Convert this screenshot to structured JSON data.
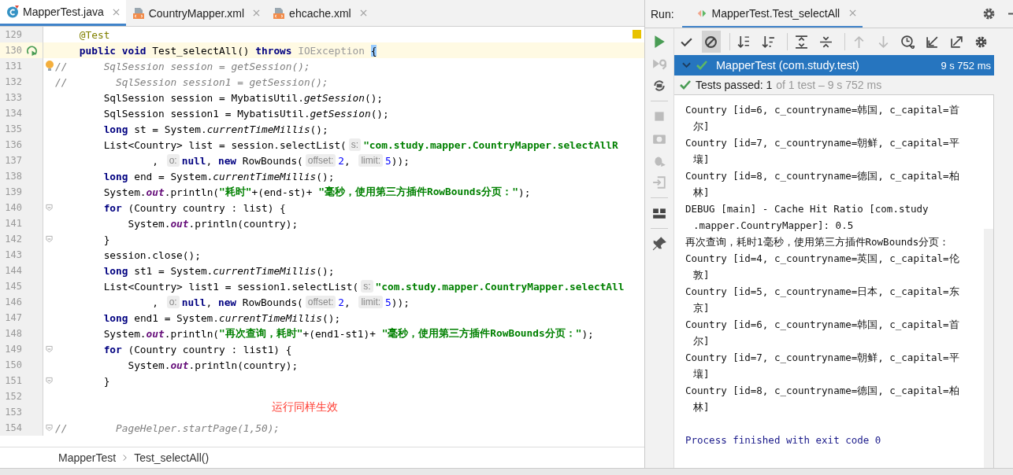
{
  "editor_tabs": [
    {
      "label": "MapperTest.java",
      "kind": "java",
      "selected": true
    },
    {
      "label": "CountryMapper.xml",
      "kind": "xml",
      "selected": false
    },
    {
      "label": "ehcache.xml",
      "kind": "xml",
      "selected": false
    }
  ],
  "code_lines": [
    {
      "number": "129",
      "current": false,
      "kind": "plain",
      "tokens": [
        {
          "kind": "ann",
          "text": "    @Test"
        }
      ]
    },
    {
      "number": "130",
      "current": true,
      "kind": "run",
      "tokens": [
        {
          "kind": "kw",
          "text": "    public void "
        },
        {
          "kind": "txt",
          "text": "Test_selectAll() "
        },
        {
          "kind": "kw",
          "text": "throws "
        },
        {
          "kind": "type",
          "text": "IOException "
        },
        {
          "kind": "brace",
          "text": "{"
        }
      ]
    },
    {
      "number": "131",
      "current": false,
      "kind": "bulb",
      "tokens": [
        {
          "kind": "cmt",
          "text": "//      SqlSession session = getSession();"
        }
      ]
    },
    {
      "number": "132",
      "current": false,
      "kind": "plain",
      "tokens": [
        {
          "kind": "cmt",
          "text": "//        SqlSession session1 = getSession();"
        }
      ]
    },
    {
      "number": "133",
      "current": false,
      "kind": "plain",
      "tokens": [
        {
          "kind": "txt",
          "text": "        SqlSession session = MybatisUtil."
        },
        {
          "kind": "ital",
          "text": "getSession"
        },
        {
          "kind": "txt",
          "text": "();"
        }
      ]
    },
    {
      "number": "134",
      "current": false,
      "kind": "plain",
      "tokens": [
        {
          "kind": "txt",
          "text": "        SqlSession session1 = MybatisUtil."
        },
        {
          "kind": "ital",
          "text": "getSession"
        },
        {
          "kind": "txt",
          "text": "();"
        }
      ]
    },
    {
      "number": "135",
      "current": false,
      "kind": "plain",
      "tokens": [
        {
          "kind": "kw",
          "text": "        long "
        },
        {
          "kind": "txt",
          "text": "st = System."
        },
        {
          "kind": "ital",
          "text": "currentTimeMillis"
        },
        {
          "kind": "txt",
          "text": "();"
        }
      ]
    },
    {
      "number": "136",
      "current": false,
      "kind": "plain",
      "tokens": [
        {
          "kind": "txt",
          "text": "        List<Country> list = session.selectList("
        },
        {
          "kind": "hint",
          "text": "s:"
        },
        {
          "kind": "str",
          "text": "\"com.study.mapper.CountryMapper.selectAllR"
        }
      ]
    },
    {
      "number": "137",
      "current": false,
      "kind": "plain",
      "tokens": [
        {
          "kind": "txt",
          "text": "                , "
        },
        {
          "kind": "hint",
          "text": "o:"
        },
        {
          "kind": "kw",
          "text": "null"
        },
        {
          "kind": "txt",
          "text": ", "
        },
        {
          "kind": "kw",
          "text": "new "
        },
        {
          "kind": "txt",
          "text": "RowBounds("
        },
        {
          "kind": "hint",
          "text": "offset:"
        },
        {
          "kind": "num",
          "text": "2"
        },
        {
          "kind": "txt",
          "text": ", "
        },
        {
          "kind": "hint",
          "text": "limit:"
        },
        {
          "kind": "num",
          "text": "5"
        },
        {
          "kind": "txt",
          "text": "));"
        }
      ]
    },
    {
      "number": "138",
      "current": false,
      "kind": "plain",
      "tokens": [
        {
          "kind": "kw",
          "text": "        long "
        },
        {
          "kind": "txt",
          "text": "end = System."
        },
        {
          "kind": "ital",
          "text": "currentTimeMillis"
        },
        {
          "kind": "txt",
          "text": "();"
        }
      ]
    },
    {
      "number": "139",
      "current": false,
      "kind": "plain",
      "tokens": [
        {
          "kind": "txt",
          "text": "        System."
        },
        {
          "kind": "field",
          "text": "out"
        },
        {
          "kind": "txt",
          "text": ".println("
        },
        {
          "kind": "str",
          "text": "\"耗时\""
        },
        {
          "kind": "txt",
          "text": "+(end-st)+ "
        },
        {
          "kind": "str",
          "text": "\"毫秒，使用第三方插件RowBounds分页：\""
        },
        {
          "kind": "txt",
          "text": ");"
        }
      ]
    },
    {
      "number": "140",
      "current": false,
      "kind": "fold",
      "tokens": [
        {
          "kind": "kw",
          "text": "        for "
        },
        {
          "kind": "txt",
          "text": "(Country country : list) {"
        }
      ]
    },
    {
      "number": "141",
      "current": false,
      "kind": "plain",
      "tokens": [
        {
          "kind": "txt",
          "text": "            System."
        },
        {
          "kind": "field",
          "text": "out"
        },
        {
          "kind": "txt",
          "text": ".println(country);"
        }
      ]
    },
    {
      "number": "142",
      "current": false,
      "kind": "fold",
      "tokens": [
        {
          "kind": "txt",
          "text": "        }"
        }
      ]
    },
    {
      "number": "143",
      "current": false,
      "kind": "plain",
      "tokens": [
        {
          "kind": "txt",
          "text": "        session.close();"
        }
      ]
    },
    {
      "number": "144",
      "current": false,
      "kind": "plain",
      "tokens": [
        {
          "kind": "kw",
          "text": "        long "
        },
        {
          "kind": "txt",
          "text": "st1 = System."
        },
        {
          "kind": "ital",
          "text": "currentTimeMillis"
        },
        {
          "kind": "txt",
          "text": "();"
        }
      ]
    },
    {
      "number": "145",
      "current": false,
      "kind": "plain",
      "tokens": [
        {
          "kind": "txt",
          "text": "        List<Country> list1 = session1.selectList("
        },
        {
          "kind": "hint",
          "text": "s:"
        },
        {
          "kind": "str",
          "text": "\"com.study.mapper.CountryMapper.selectAll"
        }
      ]
    },
    {
      "number": "146",
      "current": false,
      "kind": "plain",
      "tokens": [
        {
          "kind": "txt",
          "text": "                , "
        },
        {
          "kind": "hint",
          "text": "o:"
        },
        {
          "kind": "kw",
          "text": "null"
        },
        {
          "kind": "txt",
          "text": ", "
        },
        {
          "kind": "kw",
          "text": "new "
        },
        {
          "kind": "txt",
          "text": "RowBounds("
        },
        {
          "kind": "hint",
          "text": "offset:"
        },
        {
          "kind": "num",
          "text": "2"
        },
        {
          "kind": "txt",
          "text": ", "
        },
        {
          "kind": "hint",
          "text": "limit:"
        },
        {
          "kind": "num",
          "text": "5"
        },
        {
          "kind": "txt",
          "text": "));"
        }
      ]
    },
    {
      "number": "147",
      "current": false,
      "kind": "plain",
      "tokens": [
        {
          "kind": "kw",
          "text": "        long "
        },
        {
          "kind": "txt",
          "text": "end1 = System."
        },
        {
          "kind": "ital",
          "text": "currentTimeMillis"
        },
        {
          "kind": "txt",
          "text": "();"
        }
      ]
    },
    {
      "number": "148",
      "current": false,
      "kind": "plain",
      "tokens": [
        {
          "kind": "txt",
          "text": "        System."
        },
        {
          "kind": "field",
          "text": "out"
        },
        {
          "kind": "txt",
          "text": ".println("
        },
        {
          "kind": "str",
          "text": "\"再次查询，耗时\""
        },
        {
          "kind": "txt",
          "text": "+(end1-st1)+ "
        },
        {
          "kind": "str",
          "text": "\"毫秒，使用第三方插件RowBounds分页：\""
        },
        {
          "kind": "txt",
          "text": ");"
        }
      ]
    },
    {
      "number": "149",
      "current": false,
      "kind": "fold",
      "tokens": [
        {
          "kind": "kw",
          "text": "        for "
        },
        {
          "kind": "txt",
          "text": "(Country country : list1) {"
        }
      ]
    },
    {
      "number": "150",
      "current": false,
      "kind": "plain",
      "tokens": [
        {
          "kind": "txt",
          "text": "            System."
        },
        {
          "kind": "field",
          "text": "out"
        },
        {
          "kind": "txt",
          "text": ".println(country);"
        }
      ]
    },
    {
      "number": "151",
      "current": false,
      "kind": "fold",
      "tokens": [
        {
          "kind": "txt",
          "text": "        }"
        }
      ]
    },
    {
      "number": "152",
      "current": false,
      "kind": "plain"
    },
    {
      "number": "153",
      "current": false,
      "kind": "plain"
    },
    {
      "number": "154",
      "current": false,
      "kind": "fold",
      "tokens": [
        {
          "kind": "cmt",
          "text": "//        PageHelper.startPage(1,50);"
        }
      ]
    }
  ],
  "annotation": "运行同样生效",
  "breadcrumb": [
    "MapperTest",
    "Test_selectAll()"
  ],
  "run_panel": {
    "label": "Run:",
    "tab": "MapperTest.Test_selectAll",
    "side_tools": [
      {
        "kind": "rerun",
        "disabled": false
      },
      {
        "kind": "rerun-failed",
        "disabled": true
      },
      {
        "kind": "auto",
        "disabled": false
      },
      {
        "kind": "stop",
        "disabled": true
      },
      {
        "kind": "camera",
        "disabled": true
      },
      {
        "kind": "bug",
        "disabled": true
      },
      {
        "kind": "import",
        "disabled": true
      },
      {
        "kind": "layout",
        "disabled": false
      },
      {
        "kind": "pin",
        "disabled": false
      }
    ],
    "toolbar": [
      {
        "kind": "check",
        "selected": false,
        "disabled": false
      },
      {
        "kind": "ignored",
        "selected": true,
        "disabled": false
      },
      {
        "kind": "sort-alpha",
        "selected": false,
        "disabled": false
      },
      {
        "kind": "sort-duration",
        "selected": false,
        "disabled": false
      },
      {
        "kind": "expand",
        "selected": false,
        "disabled": false
      },
      {
        "kind": "collapse",
        "selected": false,
        "disabled": false
      },
      {
        "kind": "up",
        "selected": false,
        "disabled": true
      },
      {
        "kind": "down",
        "selected": false,
        "disabled": true
      },
      {
        "kind": "history",
        "selected": false,
        "disabled": false
      },
      {
        "kind": "import",
        "selected": false,
        "disabled": false
      },
      {
        "kind": "export",
        "selected": false,
        "disabled": false
      },
      {
        "kind": "settings",
        "selected": false,
        "disabled": false
      }
    ],
    "tree_row": {
      "label": "MapperTest (com.study.test)",
      "time": "9 s 752 ms",
      "selected": true
    },
    "status": {
      "passed": "Tests passed: 1",
      "detail": "of 1 test – 9 s 752 ms"
    },
    "console": [
      {
        "kind": "out",
        "text": "Country [id=6, c_countryname=韩国, c_capital=首",
        "wrap": "尔]"
      },
      {
        "kind": "out",
        "text": "Country [id=7, c_countryname=朝鲜, c_capital=平",
        "wrap": "壤]"
      },
      {
        "kind": "out",
        "text": "Country [id=8, c_countryname=德国, c_capital=柏",
        "wrap": "林]"
      },
      {
        "kind": "out",
        "text": "DEBUG [main] - Cache Hit Ratio [com.study",
        "wrap": ".mapper.CountryMapper]: 0.5"
      },
      {
        "kind": "out",
        "text": "再次查询，耗时1毫秒，使用第三方插件RowBounds分页："
      },
      {
        "kind": "out",
        "text": "Country [id=4, c_countryname=英国, c_capital=伦",
        "wrap": "敦]"
      },
      {
        "kind": "out",
        "text": "Country [id=5, c_countryname=日本, c_capital=东",
        "wrap": "京]"
      },
      {
        "kind": "out",
        "text": "Country [id=6, c_countryname=韩国, c_capital=首",
        "wrap": "尔]"
      },
      {
        "kind": "out",
        "text": "Country [id=7, c_countryname=朝鲜, c_capital=平",
        "wrap": "壤]"
      },
      {
        "kind": "out",
        "text": "Country [id=8, c_countryname=德国, c_capital=柏",
        "wrap": "林]"
      },
      {
        "kind": "blank"
      },
      {
        "kind": "exit",
        "text": "Process finished with exit code 0"
      }
    ]
  }
}
